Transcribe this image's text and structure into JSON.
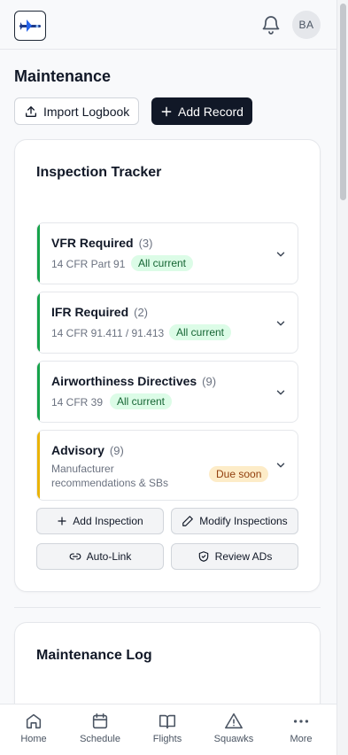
{
  "header": {
    "avatar_initials": "BA"
  },
  "page": {
    "title": "Maintenance",
    "import_label": "Import Logbook",
    "add_label": "Add Record"
  },
  "tracker": {
    "title": "Inspection Tracker",
    "groups": [
      {
        "name": "VFR Required",
        "count": "(3)",
        "sub": "14 CFR Part 91",
        "badge": "All current",
        "status": "ok"
      },
      {
        "name": "IFR Required",
        "count": "(2)",
        "sub": "14 CFR 91.411 / 91.413",
        "badge": "All current",
        "status": "ok"
      },
      {
        "name": "Airworthiness Directives",
        "count": "(9)",
        "sub": "14 CFR 39",
        "badge": "All current",
        "status": "ok"
      },
      {
        "name": "Advisory",
        "count": "(9)",
        "sub": "Manufacturer recommendations & SBs",
        "badge": "Due soon",
        "status": "warn"
      }
    ],
    "actions": {
      "add_inspection": "Add Inspection",
      "modify_inspections": "Modify Inspections",
      "auto_link": "Auto-Link",
      "review_ads": "Review ADs"
    }
  },
  "log": {
    "title": "Maintenance Log"
  },
  "nav": {
    "home": "Home",
    "schedule": "Schedule",
    "flights": "Flights",
    "squawks": "Squawks",
    "more": "More"
  },
  "colors": {
    "ok_bar": "#16a34a",
    "warn_bar": "#eab308",
    "dark": "#111827"
  }
}
